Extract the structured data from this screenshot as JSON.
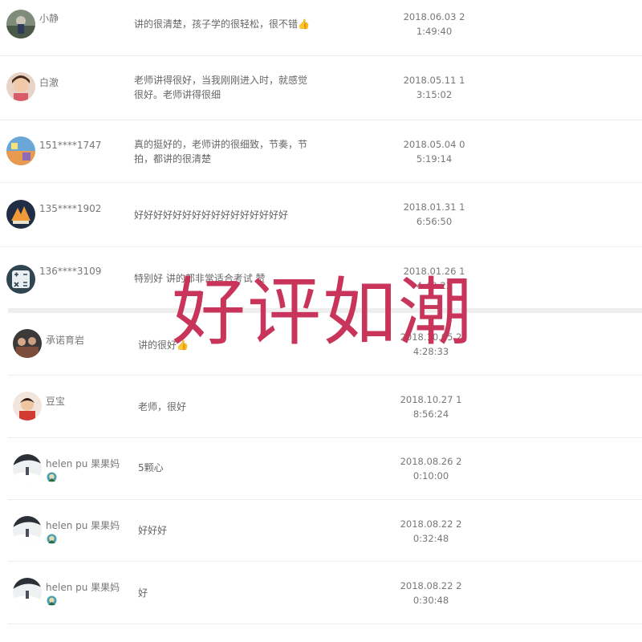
{
  "reviews": [
    {
      "name": "小静",
      "comment": [
        "讲的很清楚，孩子学的很轻松，很不错👍"
      ],
      "time": [
        "2018.06.03 2",
        "1:49:40"
      ],
      "avatar": "photo-avatar"
    },
    {
      "name": "白澈",
      "comment": [
        "老师讲得很好，当我刚刚进入时，就感觉",
        "很好。老师讲得很细"
      ],
      "time": [
        "2018.05.11 1",
        "3:15:02"
      ],
      "avatar": "child-photo-avatar"
    },
    {
      "name": "151****1747",
      "comment": [
        "真的挺好的，老师讲的很细致，节奏，节",
        "拍，都讲的很清楚"
      ],
      "time": [
        "2018.05.04 0",
        "5:19:14"
      ],
      "avatar": "app-icon-avatar"
    },
    {
      "name": "135****1902",
      "comment": [
        "好好好好好好好好好好好好好好好好"
      ],
      "time": [
        "2018.01.31 1",
        "6:56:50"
      ],
      "avatar": "game-icon-avatar"
    },
    {
      "name": "136****3109",
      "comment": [
        "特别好 讲的都非常适合考试 赞"
      ],
      "time": [
        "2018.01.26 1",
        "4:49:22"
      ],
      "avatar": "calculator-icon-avatar"
    },
    {
      "name": "承诺育岩",
      "comment": [
        "讲的很好👍"
      ],
      "time": [
        "2018.10.05 2",
        "4:28:33"
      ],
      "avatar": "group-photo-avatar"
    },
    {
      "name": "豆宝",
      "comment": [
        "老师，很好"
      ],
      "time": [
        "2018.10.27 1",
        "8:56:24"
      ],
      "avatar": "child-photo-avatar"
    },
    {
      "name": "helen pu 果果妈",
      "comment": [
        "5颗心"
      ],
      "time": [
        "2018.08.26 2",
        "0:10:00"
      ],
      "avatar": "winter-photo-avatar",
      "badge": "member-badge-icon"
    },
    {
      "name": "helen pu 果果妈",
      "comment": [
        "好好好"
      ],
      "time": [
        "2018.08.22 2",
        "0:32:48"
      ],
      "avatar": "winter-photo-avatar",
      "badge": "member-badge-icon"
    },
    {
      "name": "helen pu 果果妈",
      "comment": [
        "好"
      ],
      "time": [
        "2018.08.22 2",
        "0:30:48"
      ],
      "avatar": "winter-photo-avatar",
      "badge": "member-badge-icon"
    }
  ],
  "overlay_text": "好评如潮",
  "colors": {
    "overlay": "#c8345a",
    "divider": "#eeeeee",
    "text": "#666666"
  }
}
